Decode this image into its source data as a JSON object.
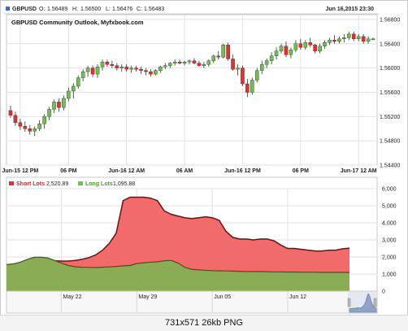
{
  "header": {
    "symbol": "GBPUSD",
    "o_label": "O:",
    "o_value": "1.56489",
    "h_label": "H:",
    "h_value": "1.56500",
    "l_label": "L:",
    "l_value": "1.56476",
    "c_label": "C:",
    "c_value": "1.56483",
    "datetime": "Jun 16,2015 23:30"
  },
  "footer_text": "731x571  26kb  PNG",
  "colors": {
    "bull": "#6cc24a",
    "bear": "#ee2b2b",
    "short_fill": "#f26b6b",
    "short_line": "#7a0c0c",
    "long_fill": "#8aac55",
    "long_line": "#3b5a14",
    "grid": "#e2e2e2",
    "border": "#c9c9c9",
    "navigator_fill": "#8ea3c6"
  },
  "chart_data": [
    {
      "type": "candlestick",
      "title": "GBPUSD Community Outlook, Myfxbook.com",
      "x_tick_labels": [
        "Jun-15 12 PM",
        "06 PM",
        "Jun-16 12 AM",
        "06 AM",
        "Jun-16 12 PM",
        "06 PM",
        "Jun-17 12 AM"
      ],
      "y_tick_labels": [
        "1.56800",
        "1.56400",
        "1.56000",
        "1.55600",
        "1.55200",
        "1.54800",
        "1.54400"
      ],
      "ylim": [
        1.544,
        1.5688
      ],
      "grid": true,
      "candles": [
        [
          1.553,
          1.5538,
          1.5518,
          1.5522
        ],
        [
          1.5522,
          1.5528,
          1.5505,
          1.551
        ],
        [
          1.551,
          1.5516,
          1.5498,
          1.5504
        ],
        [
          1.5504,
          1.5512,
          1.5495,
          1.55
        ],
        [
          1.55,
          1.5506,
          1.549,
          1.5496
        ],
        [
          1.5496,
          1.5504,
          1.5488,
          1.55
        ],
        [
          1.55,
          1.5514,
          1.5496,
          1.5508
        ],
        [
          1.5508,
          1.5524,
          1.55,
          1.552
        ],
        [
          1.552,
          1.5536,
          1.5514,
          1.5532
        ],
        [
          1.5532,
          1.5548,
          1.5526,
          1.5544
        ],
        [
          1.5544,
          1.555,
          1.5528,
          1.5535
        ],
        [
          1.5535,
          1.5555,
          1.553,
          1.555
        ],
        [
          1.555,
          1.5568,
          1.5545,
          1.5562
        ],
        [
          1.5562,
          1.5575,
          1.555,
          1.557
        ],
        [
          1.557,
          1.5588,
          1.5566,
          1.5584
        ],
        [
          1.5584,
          1.5598,
          1.5578,
          1.5594
        ],
        [
          1.5594,
          1.5604,
          1.5586,
          1.56
        ],
        [
          1.56,
          1.5604,
          1.5585,
          1.559
        ],
        [
          1.559,
          1.5606,
          1.5584,
          1.5602
        ],
        [
          1.5602,
          1.5614,
          1.5596,
          1.561
        ],
        [
          1.561,
          1.5614,
          1.5602,
          1.5606
        ],
        [
          1.5606,
          1.5612,
          1.56,
          1.5604
        ],
        [
          1.5604,
          1.5608,
          1.5596,
          1.56
        ],
        [
          1.56,
          1.5606,
          1.5594,
          1.5602
        ],
        [
          1.5602,
          1.5606,
          1.5594,
          1.5598
        ],
        [
          1.5598,
          1.5604,
          1.5592,
          1.56
        ],
        [
          1.56,
          1.5604,
          1.5594,
          1.5598
        ],
        [
          1.5598,
          1.5602,
          1.559,
          1.5596
        ],
        [
          1.5596,
          1.56,
          1.5588,
          1.5594
        ],
        [
          1.5594,
          1.5598,
          1.5586,
          1.559
        ],
        [
          1.559,
          1.5598,
          1.5588,
          1.5596
        ],
        [
          1.5596,
          1.5604,
          1.5592,
          1.5602
        ],
        [
          1.5602,
          1.5608,
          1.5598,
          1.5604
        ],
        [
          1.5604,
          1.561,
          1.56,
          1.5608
        ],
        [
          1.5608,
          1.5614,
          1.5604,
          1.561
        ],
        [
          1.561,
          1.5614,
          1.5606,
          1.5608
        ],
        [
          1.5608,
          1.5612,
          1.5604,
          1.561
        ],
        [
          1.561,
          1.5614,
          1.5606,
          1.5612
        ],
        [
          1.5612,
          1.5616,
          1.5606,
          1.5608
        ],
        [
          1.5608,
          1.5612,
          1.5602,
          1.5604
        ],
        [
          1.5604,
          1.561,
          1.56,
          1.5606
        ],
        [
          1.5606,
          1.5614,
          1.5602,
          1.5612
        ],
        [
          1.5612,
          1.5622,
          1.5608,
          1.562
        ],
        [
          1.562,
          1.5628,
          1.5614,
          1.5618
        ],
        [
          1.5618,
          1.564,
          1.5616,
          1.5638
        ],
        [
          1.5638,
          1.5642,
          1.5612,
          1.5615
        ],
        [
          1.5615,
          1.5622,
          1.5596,
          1.5598
        ],
        [
          1.5598,
          1.5606,
          1.5588,
          1.56
        ],
        [
          1.56,
          1.5604,
          1.557,
          1.5574
        ],
        [
          1.5574,
          1.5582,
          1.5552,
          1.556
        ],
        [
          1.556,
          1.5584,
          1.5556,
          1.558
        ],
        [
          1.558,
          1.56,
          1.5576,
          1.5596
        ],
        [
          1.5596,
          1.5612,
          1.559,
          1.5606
        ],
        [
          1.5606,
          1.5616,
          1.56,
          1.5612
        ],
        [
          1.5612,
          1.5626,
          1.5606,
          1.562
        ],
        [
          1.562,
          1.5634,
          1.5614,
          1.5628
        ],
        [
          1.5628,
          1.564,
          1.5624,
          1.5636
        ],
        [
          1.5636,
          1.5644,
          1.5618,
          1.5622
        ],
        [
          1.5622,
          1.5634,
          1.5616,
          1.563
        ],
        [
          1.563,
          1.5646,
          1.5626,
          1.564
        ],
        [
          1.564,
          1.5648,
          1.563,
          1.5634
        ],
        [
          1.5634,
          1.5646,
          1.563,
          1.5642
        ],
        [
          1.5642,
          1.565,
          1.5634,
          1.5638
        ],
        [
          1.5638,
          1.564,
          1.5624,
          1.5628
        ],
        [
          1.5628,
          1.564,
          1.5624,
          1.5636
        ],
        [
          1.5636,
          1.5646,
          1.5632,
          1.5642
        ],
        [
          1.5642,
          1.565,
          1.5638,
          1.5646
        ],
        [
          1.5646,
          1.5654,
          1.564,
          1.5644
        ],
        [
          1.5644,
          1.5652,
          1.564,
          1.5648
        ],
        [
          1.5648,
          1.5656,
          1.5642,
          1.565
        ],
        [
          1.565,
          1.566,
          1.5646,
          1.5656
        ],
        [
          1.5656,
          1.566,
          1.5644,
          1.5648
        ],
        [
          1.5648,
          1.5656,
          1.5644,
          1.5652
        ],
        [
          1.5652,
          1.5656,
          1.564,
          1.5644
        ],
        [
          1.5644,
          1.5652,
          1.564,
          1.5648
        ],
        [
          1.5648,
          1.565,
          1.5646,
          1.5648
        ]
      ]
    },
    {
      "type": "area",
      "legend_position": "top-left",
      "x_tick_labels": [
        "May 22",
        "May 29",
        "Jun 05",
        "Jun 12"
      ],
      "y_tick_labels": [
        "6,000",
        "5,000",
        "4,000",
        "3,000",
        "2,000",
        "1,000",
        "0"
      ],
      "ylim": [
        0,
        6000
      ],
      "x": [
        0,
        2,
        4,
        6,
        8,
        10,
        12,
        14,
        16,
        18,
        20,
        22,
        24,
        26,
        28,
        30,
        32,
        34,
        36,
        38,
        40,
        42,
        44,
        46,
        48,
        50,
        52,
        54,
        56,
        58,
        60,
        62,
        64,
        66,
        68,
        70,
        72,
        74,
        76,
        78,
        80,
        82,
        84,
        86,
        88,
        90,
        92,
        94,
        96,
        98,
        100
      ],
      "series": [
        {
          "name": "Short Lots",
          "last_value": "2,520.89",
          "values": [
            1500,
            1520,
            1560,
            1620,
            1700,
            1760,
            1800,
            1780,
            1760,
            1760,
            1800,
            1860,
            1960,
            2120,
            2400,
            2800,
            3400,
            5300,
            5500,
            5500,
            5500,
            5450,
            5300,
            4700,
            4500,
            4400,
            4300,
            4250,
            4300,
            4350,
            4300,
            4150,
            3500,
            3150,
            3050,
            3050,
            3000,
            3050,
            3050,
            2950,
            2700,
            2500,
            2500,
            2450,
            2400,
            2350,
            2350,
            2400,
            2400,
            2480,
            2520
          ]
        },
        {
          "name": "Long Lots",
          "last_value": "1,095.88",
          "values": [
            1550,
            1600,
            1700,
            1850,
            1980,
            1990,
            1950,
            1800,
            1650,
            1500,
            1430,
            1400,
            1390,
            1380,
            1400,
            1420,
            1450,
            1480,
            1500,
            1620,
            1660,
            1700,
            1720,
            1780,
            1800,
            1650,
            1400,
            1280,
            1250,
            1220,
            1200,
            1190,
            1180,
            1170,
            1160,
            1150,
            1150,
            1150,
            1140,
            1130,
            1130,
            1120,
            1120,
            1110,
            1110,
            1110,
            1100,
            1100,
            1100,
            1100,
            1096
          ]
        }
      ],
      "navigator_values": [
        300,
        330,
        320,
        350,
        340,
        360,
        400,
        380,
        360,
        420,
        500,
        650,
        900,
        1300,
        1600,
        1400,
        1000,
        700,
        500,
        380,
        350
      ]
    }
  ]
}
